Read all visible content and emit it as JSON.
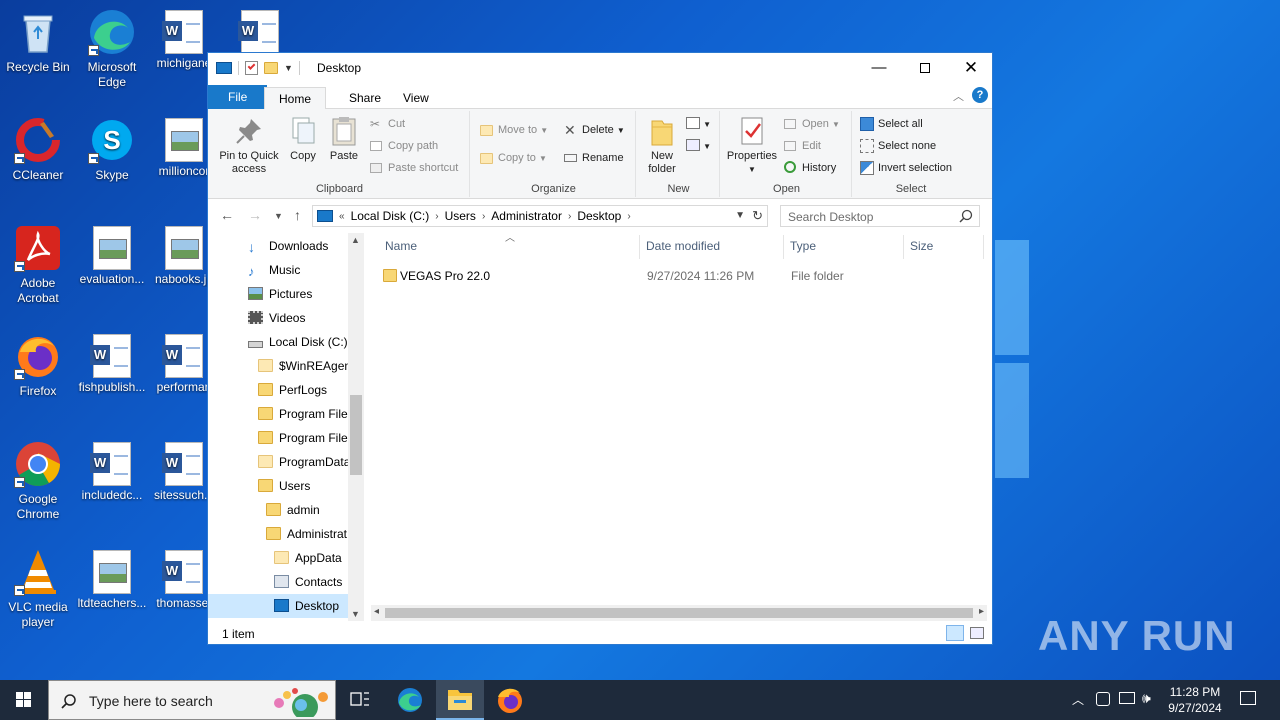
{
  "desktop": {
    "icons": [
      {
        "label": "Recycle Bin",
        "icon": "recycle-bin-icon"
      },
      {
        "label": "Microsoft Edge",
        "icon": "edge-icon"
      },
      {
        "label": "michigane",
        "icon": "word-doc-icon"
      },
      {
        "label": "",
        "icon": "word-doc-icon"
      },
      {
        "label": "CCleaner",
        "icon": "ccleaner-icon"
      },
      {
        "label": "Skype",
        "icon": "skype-icon"
      },
      {
        "label": "millioncor",
        "icon": "image-file-icon"
      },
      {
        "label": "Adobe Acrobat",
        "icon": "acrobat-icon"
      },
      {
        "label": "evaluation...",
        "icon": "image-file-icon"
      },
      {
        "label": "nabooks.jp",
        "icon": "image-file-icon"
      },
      {
        "label": "Firefox",
        "icon": "firefox-icon"
      },
      {
        "label": "fishpublish...",
        "icon": "word-doc-icon"
      },
      {
        "label": "performan",
        "icon": "word-doc-icon"
      },
      {
        "label": "Google Chrome",
        "icon": "chrome-icon"
      },
      {
        "label": "includedc...",
        "icon": "word-doc-icon"
      },
      {
        "label": "sitessuch...",
        "icon": "word-doc-icon"
      },
      {
        "label": "VLC media player",
        "icon": "vlc-icon"
      },
      {
        "label": "ltdteachers...",
        "icon": "image-file-icon"
      },
      {
        "label": "thomasset",
        "icon": "word-doc-icon"
      }
    ],
    "watermark": "ANY RUN"
  },
  "explorer": {
    "title": "Desktop",
    "tabs": {
      "file": "File",
      "home": "Home",
      "share": "Share",
      "view": "View"
    },
    "ribbon": {
      "clipboard": {
        "name": "Clipboard",
        "pin": "Pin to Quick access",
        "copy": "Copy",
        "paste": "Paste",
        "cut": "Cut",
        "copy_path": "Copy path",
        "paste_shortcut": "Paste shortcut"
      },
      "organize": {
        "name": "Organize",
        "move_to": "Move to",
        "copy_to": "Copy to",
        "delete": "Delete",
        "rename": "Rename"
      },
      "new": {
        "name": "New",
        "new_folder": "New folder"
      },
      "open": {
        "name": "Open",
        "properties": "Properties",
        "open": "Open",
        "edit": "Edit",
        "history": "History"
      },
      "select": {
        "name": "Select",
        "select_all": "Select all",
        "select_none": "Select none",
        "invert": "Invert selection"
      }
    },
    "address": {
      "crumbs": [
        "Local Disk (C:)",
        "Users",
        "Administrator",
        "Desktop"
      ],
      "search_placeholder": "Search Desktop"
    },
    "nav": [
      {
        "label": "Downloads",
        "icon": "downloads-icon"
      },
      {
        "label": "Music",
        "icon": "music-icon"
      },
      {
        "label": "Pictures",
        "icon": "pictures-icon"
      },
      {
        "label": "Videos",
        "icon": "videos-icon"
      },
      {
        "label": "Local Disk (C:)",
        "icon": "drive-icon"
      },
      {
        "label": "$WinREAgent",
        "icon": "folder-icon"
      },
      {
        "label": "PerfLogs",
        "icon": "folder-icon"
      },
      {
        "label": "Program Files",
        "icon": "folder-icon"
      },
      {
        "label": "Program Files",
        "icon": "folder-icon"
      },
      {
        "label": "ProgramData",
        "icon": "folder-icon"
      },
      {
        "label": "Users",
        "icon": "folder-icon"
      },
      {
        "label": "admin",
        "icon": "folder-icon"
      },
      {
        "label": "Administrat",
        "icon": "folder-icon"
      },
      {
        "label": "AppData",
        "icon": "folder-icon"
      },
      {
        "label": "Contacts",
        "icon": "contacts-icon"
      },
      {
        "label": "Desktop",
        "icon": "desktop-folder-icon"
      }
    ],
    "columns": {
      "name": "Name",
      "date": "Date modified",
      "type": "Type",
      "size": "Size"
    },
    "files": [
      {
        "name": "VEGAS Pro 22.0",
        "date": "9/27/2024 11:26 PM",
        "type": "File folder",
        "size": ""
      }
    ],
    "status": "1 item"
  },
  "taskbar": {
    "search_placeholder": "Type here to search",
    "time": "11:28 PM",
    "date": "9/27/2024"
  }
}
